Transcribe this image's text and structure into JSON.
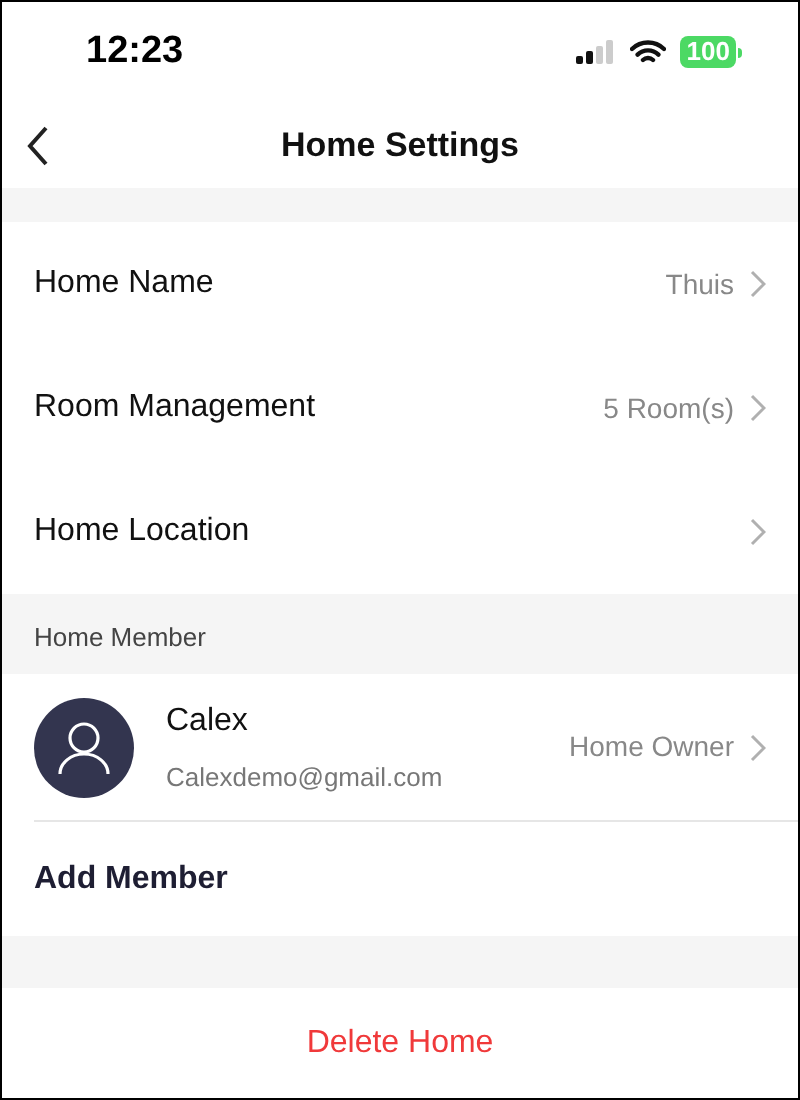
{
  "status_bar": {
    "time": "12:23",
    "battery": "100"
  },
  "nav": {
    "title": "Home Settings"
  },
  "settings": [
    {
      "label": "Home Name",
      "value": "Thuis"
    },
    {
      "label": "Room Management",
      "value": "5 Room(s)"
    },
    {
      "label": "Home Location"
    }
  ],
  "members_section": {
    "header": "Home Member",
    "members": [
      {
        "name": "Calex",
        "email": "Calexdemo@gmail.com",
        "role": "Home Owner"
      }
    ],
    "add_label": "Add Member"
  },
  "delete_label": "Delete Home"
}
